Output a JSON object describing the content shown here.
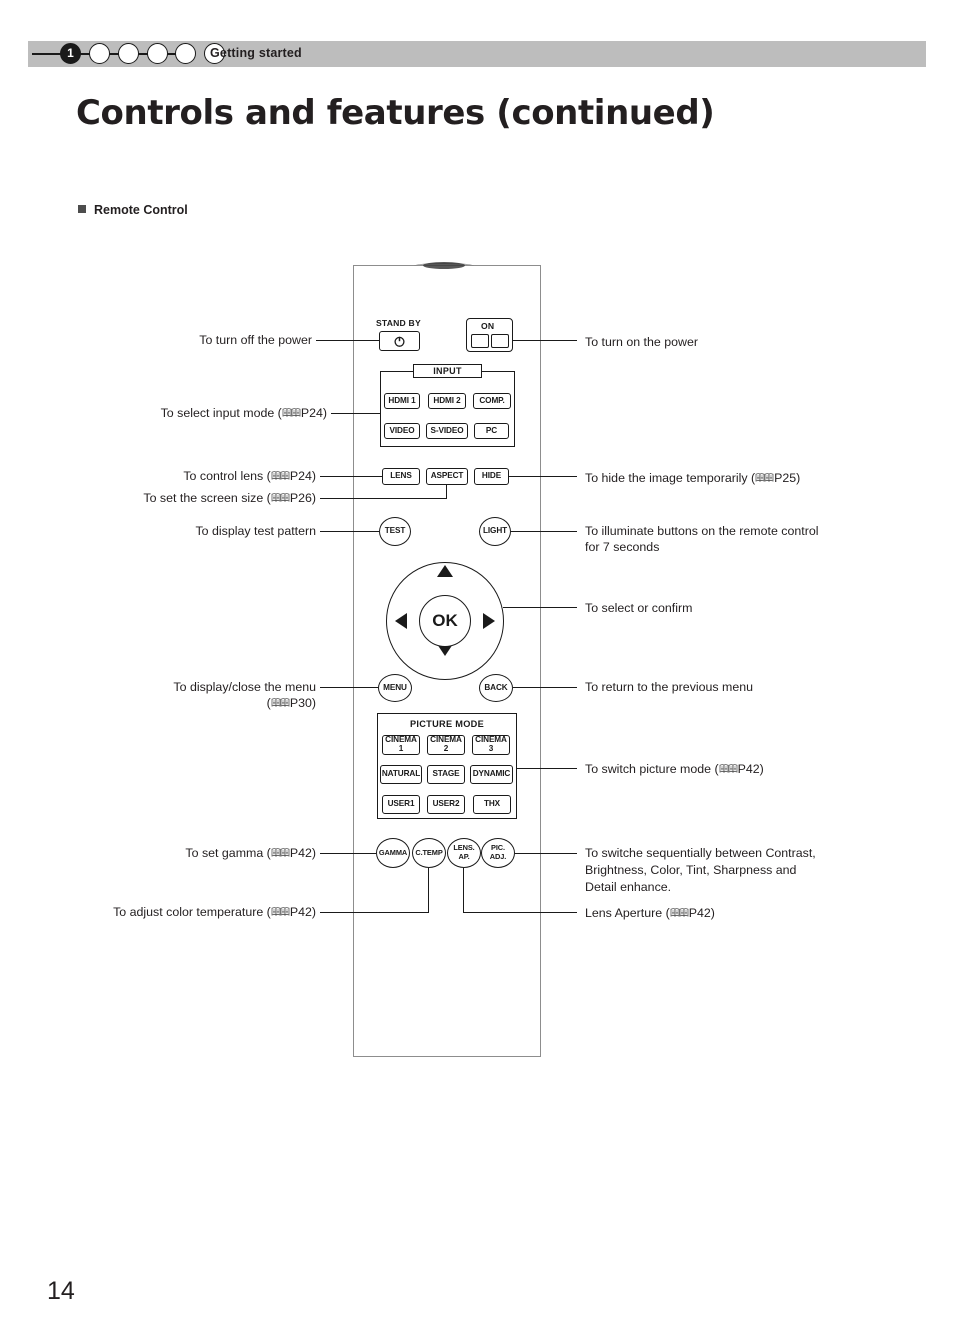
{
  "chapter_bar": {
    "current_step": "1",
    "steps": [
      "1",
      "",
      "",
      "",
      "",
      ""
    ],
    "title": "Getting started"
  },
  "page_title": "Controls and features (continued)",
  "section_heading": "Remote Control",
  "page_number": "14",
  "colors": {
    "chapter_bar_bg": "#bdbdbd",
    "text": "#231f20",
    "line": "#1a1a1a",
    "remote_outline": "#8d8d8d"
  },
  "remote": {
    "standby_label": "STAND BY",
    "standby_icon": "power-icon",
    "on_label": "ON",
    "input_group_label": "INPUT",
    "input_buttons": [
      "HDMI 1",
      "HDMI 2",
      "COMP.",
      "VIDEO",
      "S-VIDEO",
      "PC"
    ],
    "lens_button": "LENS",
    "aspect_button": "ASPECT",
    "hide_button": "HIDE",
    "test_button": "TEST",
    "light_button": "LIGHT",
    "ok_button": "OK",
    "nav_up_icon": "triangle-up-icon",
    "nav_down_icon": "triangle-down-icon",
    "nav_left_icon": "triangle-left-icon",
    "nav_right_icon": "triangle-right-icon",
    "menu_button": "MENU",
    "back_button": "BACK",
    "picture_mode_label": "PICTURE MODE",
    "picture_mode_buttons": [
      {
        "line1": "CINEMA",
        "line2": "1"
      },
      {
        "line1": "CINEMA",
        "line2": "2"
      },
      {
        "line1": "CINEMA",
        "line2": "3"
      },
      {
        "line1": "NATURAL",
        "line2": ""
      },
      {
        "line1": "STAGE",
        "line2": ""
      },
      {
        "line1": "DYNAMIC",
        "line2": ""
      },
      {
        "line1": "USER1",
        "line2": ""
      },
      {
        "line1": "USER2",
        "line2": ""
      },
      {
        "line1": "THX",
        "line2": ""
      }
    ],
    "bottom_buttons": [
      {
        "line1": "GAMMA",
        "line2": ""
      },
      {
        "line1": "C.TEMP",
        "line2": ""
      },
      {
        "line1": "LENS.",
        "line2": "AP."
      },
      {
        "line1": "PIC.",
        "line2": "ADJ."
      }
    ]
  },
  "callouts_left": {
    "power_off": "To turn off the power",
    "input_mode_pre": "To select input mode (",
    "input_mode_post": "P24)",
    "control_lens_pre": "To control lens (",
    "control_lens_post": "P24)",
    "screen_size_pre": "To set the screen size (",
    "screen_size_post": "P26)",
    "test_pattern": "To display test pattern",
    "menu_line1": "To display/close the menu",
    "menu_line2_pre": "(",
    "menu_line2_post": "P30)",
    "gamma_pre": "To set gamma (",
    "gamma_post": "P42)",
    "color_temp_pre": "To adjust color temperature (",
    "color_temp_post": "P42)"
  },
  "callouts_right": {
    "power_on": "To turn on the power",
    "hide_image_pre": "To hide the image temporarily (",
    "hide_image_post": "P25)",
    "illuminate_line1": "To illuminate buttons on the remote control",
    "illuminate_line2": "for 7 seconds",
    "select_confirm": "To select or confirm",
    "previous_menu": "To return to the previous menu",
    "picture_mode_pre": "To switch picture mode (",
    "picture_mode_post": "P42)",
    "switch_seq_line1": "To switche sequentially between Contrast,",
    "switch_seq_line2": "Brightness, Color, Tint, Sharpness and",
    "switch_seq_line3": "Detail enhance.",
    "lens_aperture_pre": "Lens Aperture (",
    "lens_aperture_post": "P42)"
  }
}
